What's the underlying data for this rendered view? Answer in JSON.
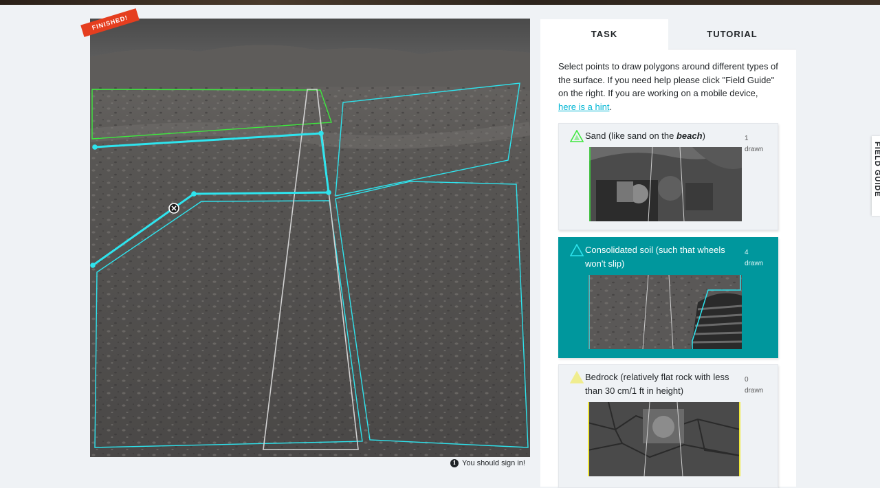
{
  "viewer": {
    "ribbon": "FINISHED!",
    "signin": "You should sign in!"
  },
  "tabs": [
    {
      "label": "TASK",
      "active": true
    },
    {
      "label": "TUTORIAL",
      "active": false
    }
  ],
  "instructions": {
    "before": "Select points to draw polygons around different types of the surface. If you need help please click \"Field Guide\" on the right. If you are working on a mobile device, ",
    "link": "here is a hint",
    "after": "."
  },
  "tools": [
    {
      "label_start": "Sand (like sand on the ",
      "label_em": "beach",
      "label_end": ")",
      "count": "1",
      "count_label": "drawn",
      "color": "#3ee83e",
      "active": false
    },
    {
      "label_start": "Consolidated soil (such that wheels won't slip)",
      "label_em": "",
      "label_end": "",
      "count": "4",
      "count_label": "drawn",
      "color": "#2ee4ee",
      "active": true
    },
    {
      "label_start": "Bedrock (relatively flat rock with less than 30 cm/1 ft in height)",
      "label_em": "",
      "label_end": "",
      "count": "0",
      "count_label": "drawn",
      "color": "#f2ea3a",
      "active": false
    }
  ],
  "field_guide": "FIELD GUIDE",
  "colors": {
    "accent": "#00979d",
    "consolidated_soil_line": "#2ee4ee",
    "sand_line": "#3ee83e",
    "ribbon": "#e53e1f"
  }
}
